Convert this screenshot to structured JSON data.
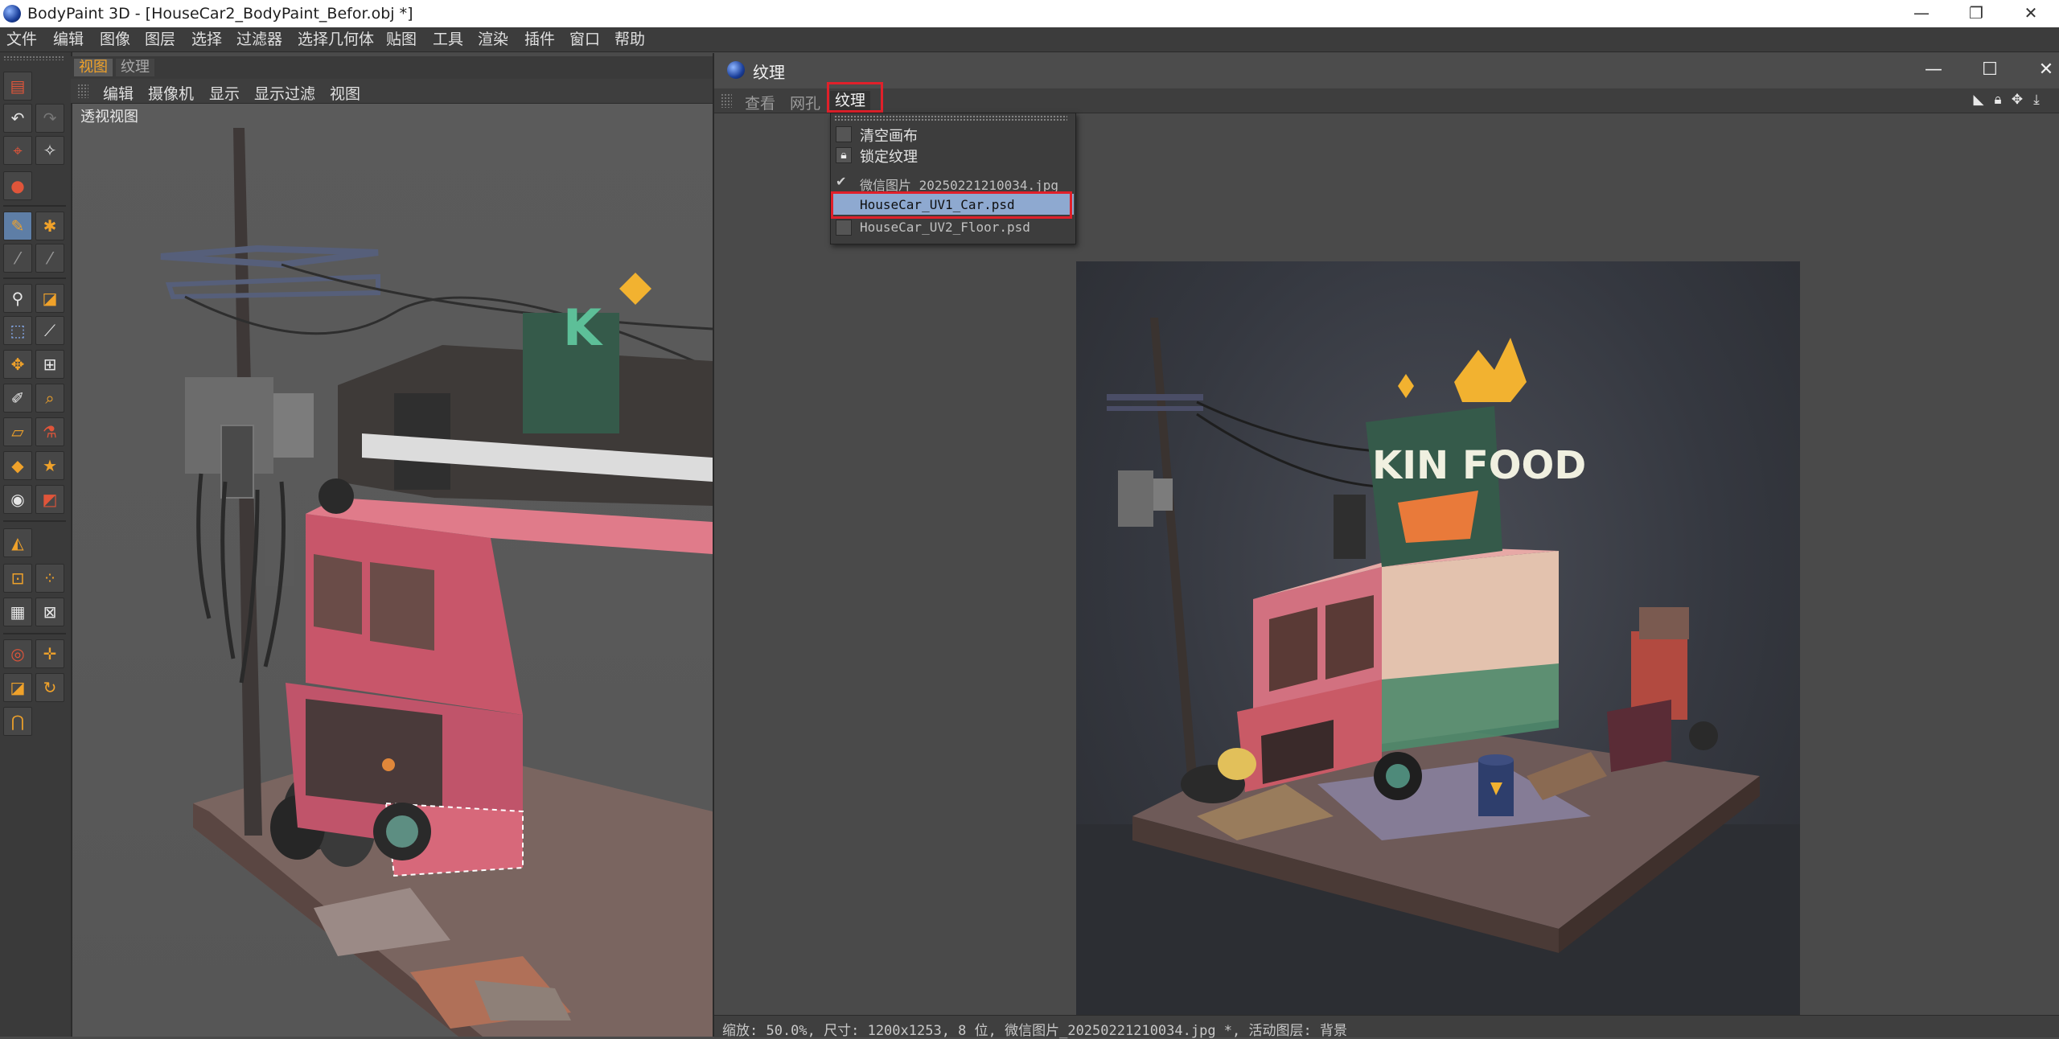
{
  "app": {
    "title": "BodyPaint 3D - [HouseCar2_BodyPaint_Befor.obj *]",
    "window_controls": [
      "—",
      "❐",
      "✕"
    ]
  },
  "menubar": {
    "items": [
      "文件",
      "编辑",
      "图像",
      "图层",
      "选择",
      "过滤器",
      "选择几何体",
      "贴图",
      "工具",
      "渲染",
      "插件",
      "窗口",
      "帮助"
    ]
  },
  "viewport": {
    "tabs": [
      "视图",
      "纹理"
    ],
    "menu": [
      "编辑",
      "摄像机",
      "显示",
      "显示过滤",
      "视图"
    ],
    "label": "透视视图"
  },
  "texture_window": {
    "title": "纹理",
    "controls": [
      "—",
      "☐",
      "✕"
    ],
    "menu": [
      "查看",
      "网孔",
      "纹理"
    ],
    "dropdown": {
      "items": [
        {
          "label": "清空画布",
          "state": "none"
        },
        {
          "label": "锁定纹理",
          "state": "lock"
        },
        {
          "label": "微信图片_20250221210034.jpg",
          "state": "checked"
        },
        {
          "label": "HouseCar_UV1_Car.psd",
          "state": "selected"
        },
        {
          "label": "HouseCar_UV2_Floor.psd",
          "state": "none"
        }
      ]
    },
    "image": {
      "sign_text": "KIN FOOD"
    },
    "status": "缩放: 50.0%, 尺寸: 1200x1253, 8 位, 微信图片_20250221210034.jpg *, 活动图层: 背景"
  },
  "colors": {
    "highlight_red": "#e0202a",
    "selected_item": "#8ea9d0",
    "tab_active": "#f0a22a",
    "truck_pink": "#c8566a"
  },
  "icons": {
    "toolbar": [
      "layout-icon",
      "undo-icon",
      "redo-icon",
      "pick-icon",
      "render-icon",
      "paint-3d-icon",
      "paint-setup-icon",
      "projection-icon",
      "projection-2-icon",
      "magic-wand-icon",
      "brush-settings-icon",
      "rect-select-icon",
      "lasso-icon",
      "transform-icon",
      "scale-icon",
      "pencil-icon",
      "smudge-icon",
      "eraser-icon",
      "eyedropper-icon",
      "fill-icon",
      "star-icon",
      "color-icon",
      "swatch-icon",
      "uv-polygon-icon",
      "uv-edit-icon",
      "uv-points-icon",
      "checker-icon",
      "uv-relax-icon",
      "live-select-icon",
      "move-icon",
      "scale-object-icon",
      "rotate-icon",
      "magnet-icon"
    ],
    "texture_view": [
      "histogram-icon",
      "lock-icon",
      "move-view-icon",
      "download-icon"
    ]
  }
}
